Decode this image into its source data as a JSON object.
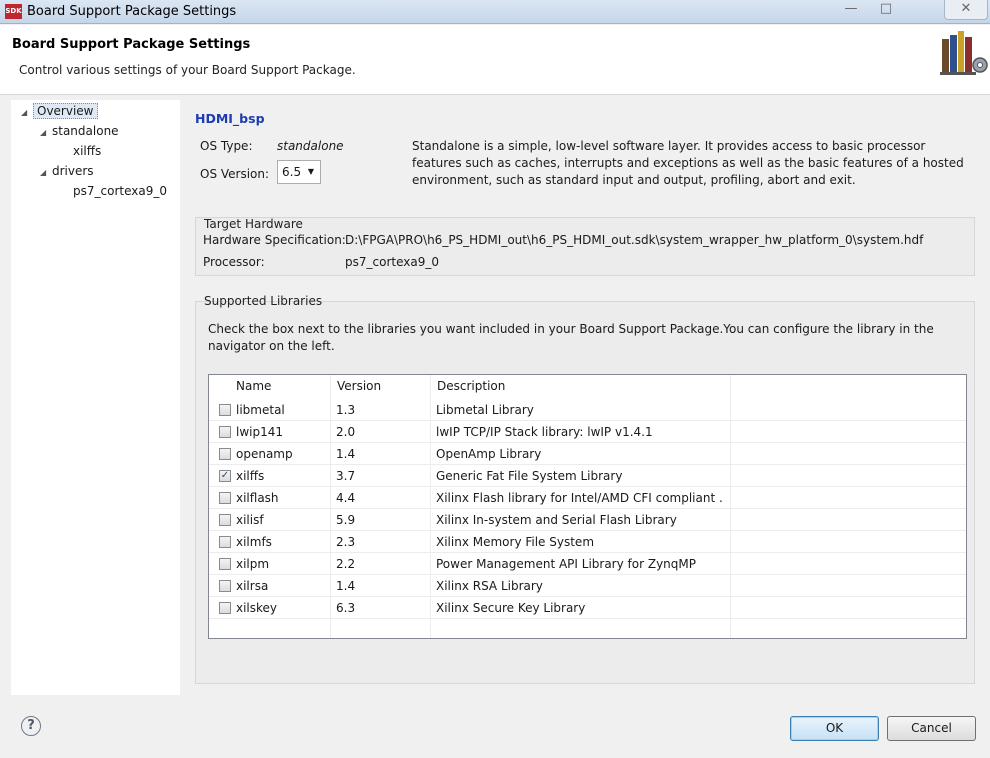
{
  "window": {
    "app_icon_text": "SDK",
    "title": "Board Support Package Settings",
    "min_symbol": "—",
    "max_symbol": "□",
    "close_symbol": "✕"
  },
  "header": {
    "title": "Board Support Package Settings",
    "description": "Control various settings of your Board Support Package.",
    "icon": "books-gear-icon"
  },
  "nav": {
    "items": [
      {
        "label": "Overview",
        "level": 0,
        "expanded": true,
        "selected": true
      },
      {
        "label": "standalone",
        "level": 1,
        "expanded": true
      },
      {
        "label": "xilffs",
        "level": 2
      },
      {
        "label": "drivers",
        "level": 1,
        "expanded": true
      },
      {
        "label": "ps7_cortexa9_0",
        "level": 2
      }
    ]
  },
  "overview": {
    "bsp_name": "HDMI_bsp",
    "os_type_label": "OS Type:",
    "os_type_value": "standalone",
    "os_version_label": "OS Version:",
    "os_version_value": "6.5",
    "os_description": "Standalone is a simple, low-level software layer. It provides access to basic processor features such as caches, interrupts and exceptions as well as the basic features of a hosted environment, such as standard input and output, profiling, abort and exit."
  },
  "target_hardware": {
    "title": "Target Hardware",
    "hw_spec_label": "Hardware Specification:",
    "hw_spec_value": "D:\\FPGA\\PRO\\h6_PS_HDMI_out\\h6_PS_HDMI_out.sdk\\system_wrapper_hw_platform_0\\system.hdf",
    "processor_label": "Processor:",
    "processor_value": "ps7_cortexa9_0"
  },
  "libraries": {
    "title": "Supported Libraries",
    "instructions": "Check the box next to the libraries you want included in your Board Support Package.You can configure the library in the navigator on the left.",
    "columns": [
      "Name",
      "Version",
      "Description"
    ],
    "rows": [
      {
        "name": "libmetal",
        "version": "1.3",
        "description": "Libmetal Library",
        "checked": false
      },
      {
        "name": "lwip141",
        "version": "2.0",
        "description": "lwIP TCP/IP Stack library: lwIP v1.4.1",
        "checked": false
      },
      {
        "name": "openamp",
        "version": "1.4",
        "description": "OpenAmp Library",
        "checked": false
      },
      {
        "name": "xilffs",
        "version": "3.7",
        "description": "Generic Fat File System Library",
        "checked": true
      },
      {
        "name": "xilflash",
        "version": "4.4",
        "description": "Xilinx Flash library for Intel/AMD CFI compliant ...",
        "checked": false
      },
      {
        "name": "xilisf",
        "version": "5.9",
        "description": "Xilinx In-system and Serial Flash Library",
        "checked": false
      },
      {
        "name": "xilmfs",
        "version": "2.3",
        "description": "Xilinx Memory File System",
        "checked": false
      },
      {
        "name": "xilpm",
        "version": "2.2",
        "description": "Power Management API Library for ZynqMP",
        "checked": false
      },
      {
        "name": "xilrsa",
        "version": "1.4",
        "description": "Xilinx RSA Library",
        "checked": false
      },
      {
        "name": "xilskey",
        "version": "6.3",
        "description": "Xilinx Secure Key Library",
        "checked": false
      }
    ]
  },
  "footer": {
    "help_symbol": "?",
    "ok_label": "OK",
    "cancel_label": "Cancel"
  }
}
